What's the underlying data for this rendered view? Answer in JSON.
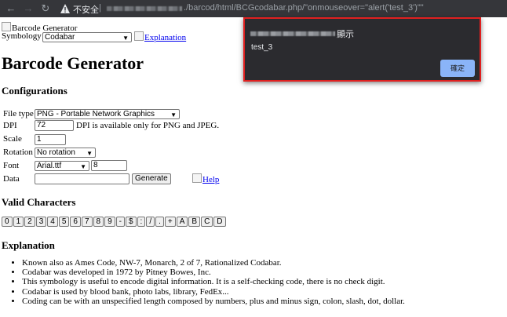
{
  "browser": {
    "insecure_label": "不安全",
    "separator": "|",
    "url_path": "./barcod/html/BCGcodabar.php/\"onmouseover=\"alert('test_3')\"\""
  },
  "page": {
    "logo_alt": "Barcode Generator",
    "symbology_label": "Symbology",
    "symbology_value": "Codabar",
    "explanation_link": "Explanation",
    "title": "Barcode Generator",
    "config_heading": "Configurations",
    "fields": {
      "filetype_label": "File type",
      "filetype_value": "PNG - Portable Network Graphics",
      "dpi_label": "DPI",
      "dpi_value": "72",
      "dpi_note": "DPI is available only for PNG and JPEG.",
      "scale_label": "Scale",
      "scale_value": "1",
      "rotation_label": "Rotation",
      "rotation_value": "No rotation",
      "font_label": "Font",
      "font_value": "Arial.ttf",
      "font_size_value": "8",
      "data_label": "Data",
      "data_value": "",
      "generate_button": "Generate",
      "help_link": "Help"
    },
    "valid_heading": "Valid Characters",
    "valid_chars": [
      "0",
      "1",
      "2",
      "3",
      "4",
      "5",
      "6",
      "7",
      "8",
      "9",
      "-",
      "$",
      ":",
      "/",
      ".",
      "+",
      "A",
      "B",
      "C",
      "D"
    ],
    "explanation_heading": "Explanation",
    "explanation_items": [
      "Known also as Ames Code, NW-7, Monarch, 2 of 7, Rationalized Codabar.",
      "Codabar was developed in 1972 by Pitney Bowes, Inc.",
      "This symbology is useful to encode digital information. It is a self-checking code, there is no check digit.",
      "Codabar is used by blood bank, photo labs, library, FedEx...",
      "Coding can be with an unspecified length composed by numbers, plus and minus sign, colon, slash, dot, dollar."
    ]
  },
  "dialog": {
    "title_suffix": "顯示",
    "message": "test_3",
    "ok_label": "確定"
  },
  "colors": {
    "chrome_bg": "#35363a",
    "dialog_bg": "#2b2b2f",
    "dialog_highlight": "#e02020",
    "ok_button": "#8ab4f8",
    "link": "#0000ee"
  }
}
